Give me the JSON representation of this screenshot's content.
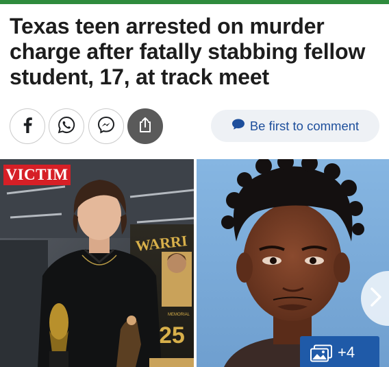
{
  "article": {
    "headline": "Texas teen arrested on murder charge after fatally stabbing fellow student, 17, at track meet"
  },
  "share": {
    "buttons": [
      {
        "name": "facebook",
        "icon": "facebook-icon",
        "color": "#1c1e21"
      },
      {
        "name": "whatsapp",
        "icon": "whatsapp-icon",
        "color": "#1c1e21"
      },
      {
        "name": "messenger",
        "icon": "messenger-icon",
        "color": "#1c1e21"
      },
      {
        "name": "share",
        "icon": "share-icon",
        "color": "#ffffff"
      }
    ]
  },
  "comments": {
    "label": "Be first to comment",
    "icon": "speech-bubble-icon",
    "color": "#1e4f9c"
  },
  "gallery": {
    "victim_label": "VICTIM",
    "count_label": "+4",
    "next_icon": "chevron-right-icon",
    "gallery_icon": "images-icon",
    "photo_left_text": [
      "MEMORIAL",
      "WARRI",
      "25"
    ]
  },
  "colors": {
    "accent_bar": "#2e8b3d",
    "victim_badge": "#d61f26",
    "gallery_badge": "#1f5aa8"
  }
}
